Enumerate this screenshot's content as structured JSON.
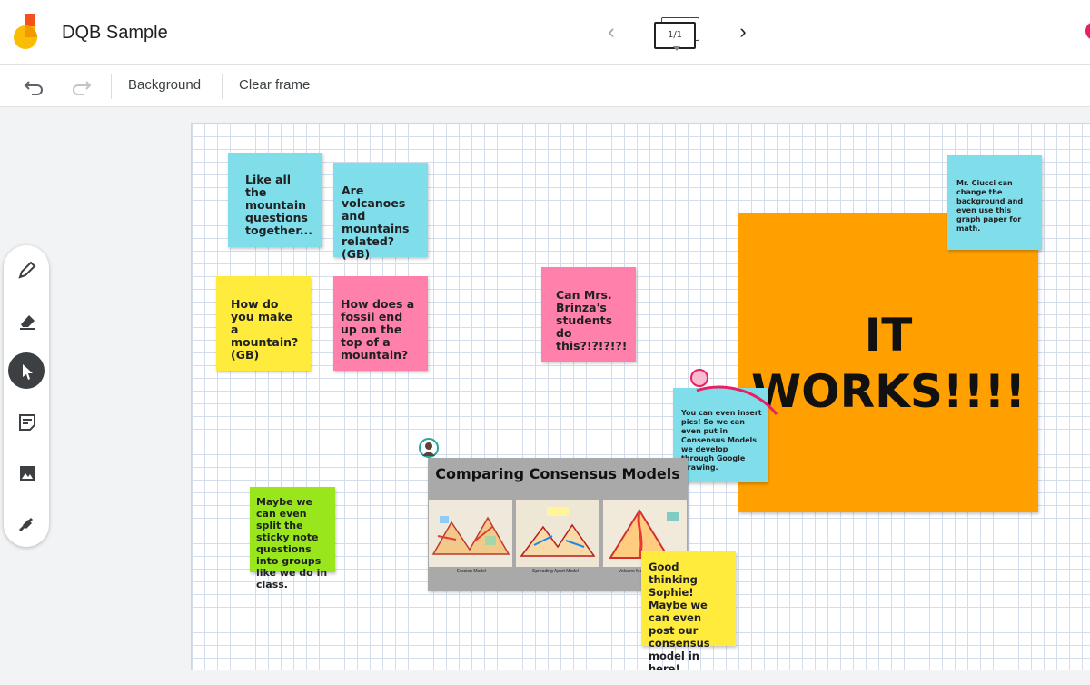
{
  "header": {
    "title": "DQB Sample",
    "frame_counter": "1/1",
    "prev_icon": "chevron-left-icon",
    "next_icon": "chevron-right-icon"
  },
  "toolbar": {
    "undo_icon": "undo-icon",
    "redo_icon": "redo-icon",
    "background_label": "Background",
    "clear_frame_label": "Clear frame"
  },
  "tools": [
    "pen-icon",
    "eraser-icon",
    "select-pointer-icon",
    "sticky-note-icon",
    "image-icon",
    "laser-icon"
  ],
  "notes": {
    "n1": "Like all the mountain questions together...",
    "n2": "Are volcanoes and mountains related? (GB)",
    "n3": "How do you make a mountain? (GB)",
    "n4": "How does a fossil end up on the top of a mountain?",
    "n5": "Can Mrs. Brinza's students do this?!?!?!?!",
    "n6": "Mr. Ciucci can change the background and even use this graph paper for math.",
    "n7": "You can even insert pics!  So we can even put in Consensus Models we develop through Google Drawing.",
    "n8": "Maybe we can even split the sticky note questions into groups like we do in class.",
    "n9": "Good thinking Sophie! Maybe we can even post our consensus model in here!"
  },
  "big_note": {
    "line1": "IT",
    "line2": "WORKS!!!!"
  },
  "image": {
    "title": "Comparing Consensus Models",
    "captions": [
      "Erosion Model",
      "Spreading Apart Model",
      "Volcano Model"
    ]
  },
  "colors": {
    "cyan": "#80deea",
    "yellow": "#ffeb3b",
    "pink": "#ff80ab",
    "green": "#9ae61c",
    "orange": "#ffa000",
    "ink": "#e91e63"
  }
}
